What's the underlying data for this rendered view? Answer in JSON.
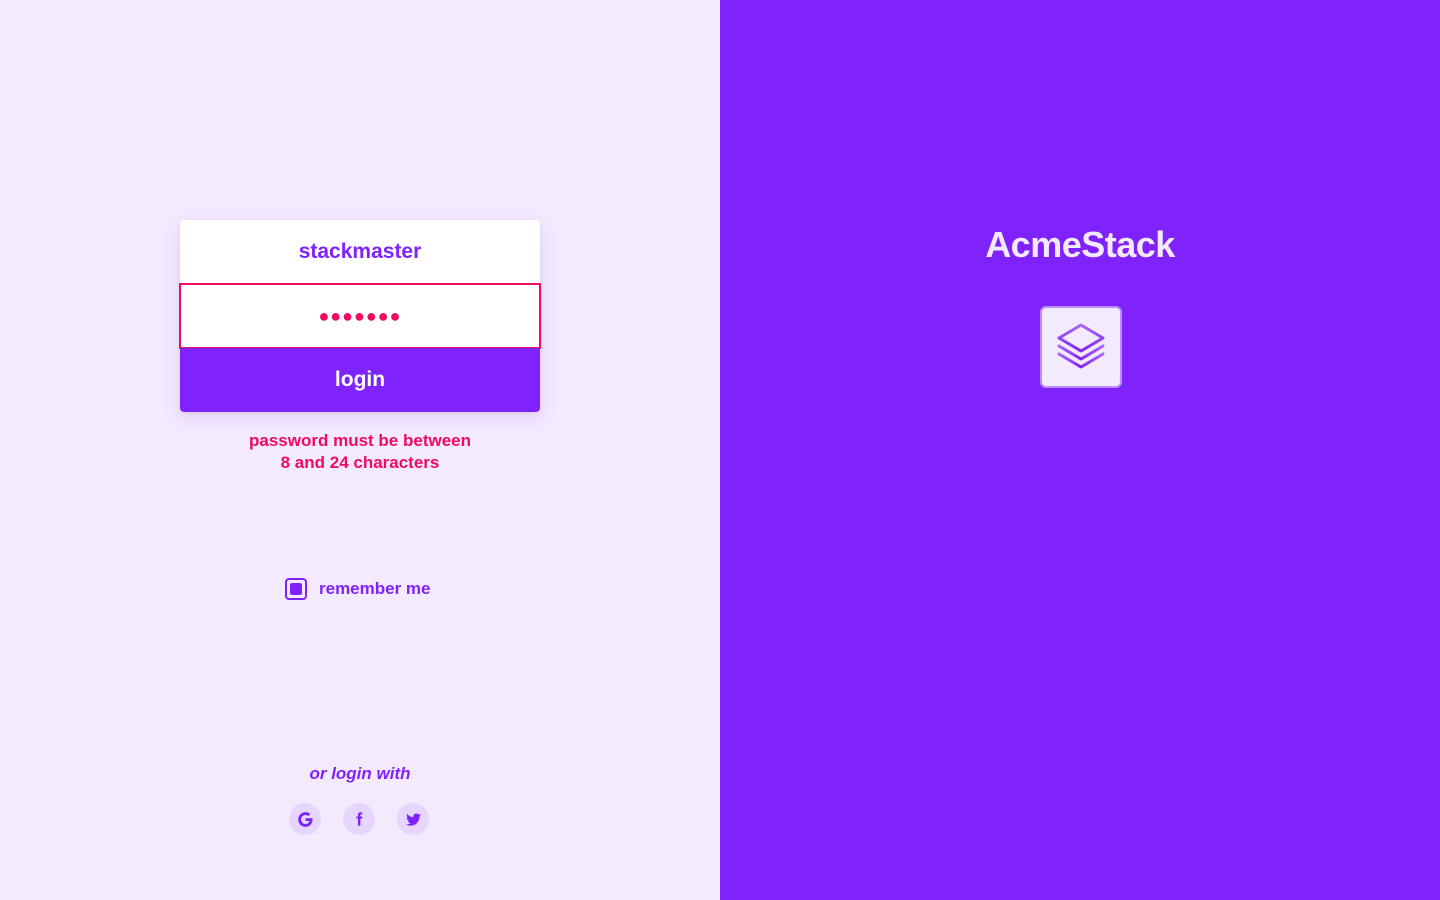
{
  "login_form": {
    "username_value": "stackmaster",
    "password_masked": "●●●●●●●",
    "login_label": "login",
    "error_line1": "password must be between",
    "error_line2": "8 and 24 characters"
  },
  "remember": {
    "label": "remember me",
    "checked": true
  },
  "social": {
    "heading": "or login with",
    "providers": [
      "google-icon",
      "facebook-icon",
      "twitter-icon"
    ]
  },
  "brand": {
    "name": "AcmeStack",
    "logo_icon": "layers-icon"
  },
  "colors": {
    "accent": "#8022fb",
    "background_light": "#f4eafe",
    "error": "#ef0a62"
  }
}
